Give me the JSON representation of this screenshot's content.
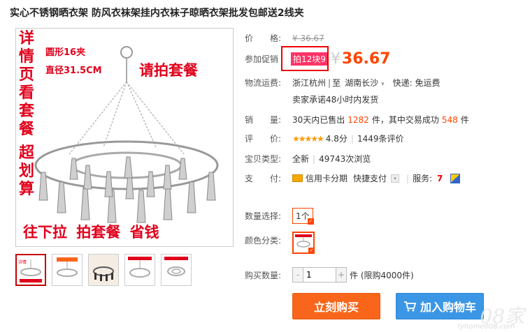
{
  "title": "实心不锈钢晒衣架 防风衣袜架挂内衣袜子晾晒衣架批发包邮送2线夹",
  "main_image": {
    "left_text": [
      "详",
      "情",
      "页",
      "看",
      "套",
      "餐",
      "超",
      "划",
      "算"
    ],
    "spec1": "圆形16夹",
    "spec2": "直径31.5CM",
    "promo_red": "请拍套餐",
    "bottom_text": "往下拉 拍套餐 省钱"
  },
  "price": {
    "label": "价　　格:",
    "original": "¥ 36.67"
  },
  "promotion": {
    "label": "参加促销",
    "tag": "拍12块9",
    "yen": "¥",
    "price": "36.67"
  },
  "shipping": {
    "label": "物流运费:",
    "from": "浙江杭州",
    "sep": "|",
    "to_prefix": "至",
    "to": "湖南长沙",
    "courier": "快递: 免运费",
    "promise": "卖家承诺48小时内发货"
  },
  "sales": {
    "label": "销　　量:",
    "prefix": "30天内已售出",
    "count": "1282",
    "middle": "件，其中交易成功",
    "success": "548",
    "suffix": "件"
  },
  "rating": {
    "label": "评　　价:",
    "stars": "★★★★★",
    "score": "4.8分",
    "reviews": "1449条评价"
  },
  "item_type": {
    "label": "宝贝类型:",
    "condition": "全新",
    "views": "49743次浏览"
  },
  "payment": {
    "label": "支　　付:",
    "credit": "信用卡分期",
    "quick": "快捷支付",
    "service": "服务:"
  },
  "quantity_select": {
    "label": "数量选择:",
    "option": "1个"
  },
  "color": {
    "label": "颜色分类:"
  },
  "buy_qty": {
    "label": "购买数量:",
    "value": "1",
    "minus": "-",
    "plus": "+",
    "note": "件 (限购4000件)"
  },
  "buttons": {
    "buy_now": "立刻购买",
    "add_cart": "加入购物车"
  },
  "watermark": {
    "big": "08家",
    "small": "tyhome008.com"
  }
}
